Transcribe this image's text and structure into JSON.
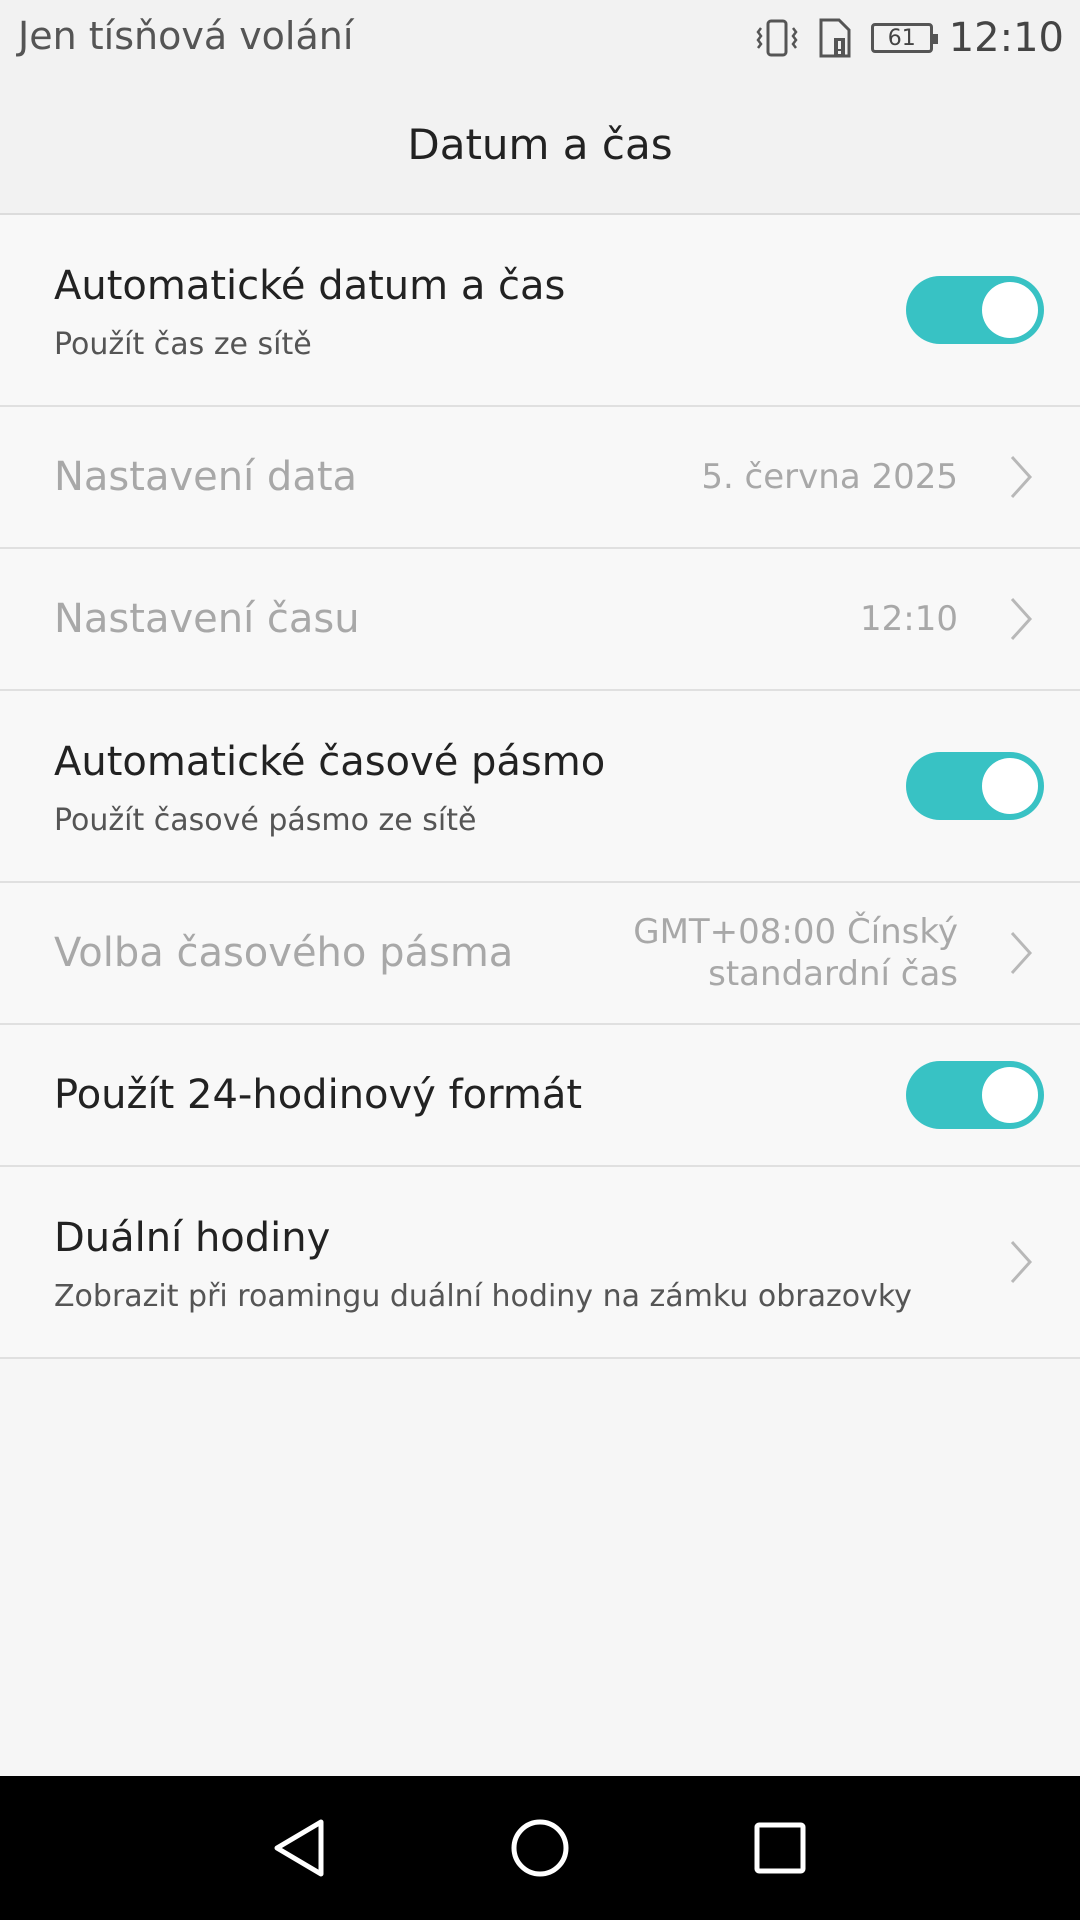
{
  "status_bar": {
    "carrier_text": "Jen tísňová volání",
    "battery_level": "61",
    "time": "12:10",
    "icons": [
      "vibrate-icon",
      "sim-alert-icon",
      "battery-icon"
    ]
  },
  "header": {
    "title": "Datum a čas"
  },
  "settings": {
    "auto_datetime": {
      "title": "Automatické datum a čas",
      "subtitle": "Použít čas ze sítě",
      "enabled": true
    },
    "set_date": {
      "title": "Nastavení data",
      "value": "5. června 2025"
    },
    "set_time": {
      "title": "Nastavení času",
      "value": "12:10"
    },
    "auto_timezone": {
      "title": "Automatické časové pásmo",
      "subtitle": "Použít časové pásmo ze sítě",
      "enabled": true
    },
    "timezone": {
      "title": "Volba časového pásma",
      "value_line1": "GMT+08:00 Čínský",
      "value_line2": "standardní čas"
    },
    "format_24h": {
      "title": "Použít 24-hodinový formát",
      "enabled": true
    },
    "dual_clock": {
      "title": "Duální hodiny",
      "subtitle": "Zobrazit při roamingu duální hodiny na zámku obrazovky"
    }
  },
  "colors": {
    "toggle_on": "#38c2c4",
    "disabled_text": "#a8a8a8"
  },
  "nav_bar": {
    "icons": [
      "back-icon",
      "home-icon",
      "recents-icon"
    ]
  }
}
